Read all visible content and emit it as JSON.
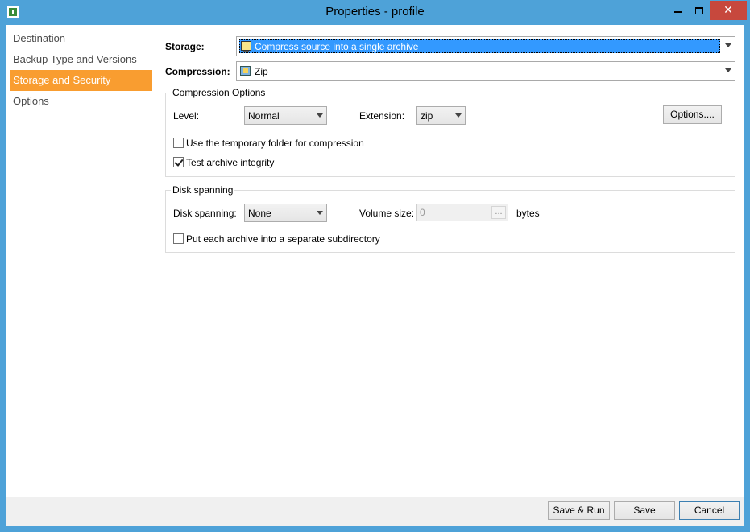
{
  "window": {
    "title": "Properties - profile"
  },
  "nav": {
    "items": [
      {
        "label": "Destination"
      },
      {
        "label": "Backup Type and Versions"
      },
      {
        "label": "Storage and Security"
      },
      {
        "label": "Options"
      }
    ],
    "active_index": 2,
    "active_color": "#f99d30"
  },
  "storage": {
    "label": "Storage:",
    "value": "Compress source into a single archive",
    "icon": "monitor-icon"
  },
  "compression": {
    "label": "Compression:",
    "value": "Zip",
    "icon": "zip-archive-icon"
  },
  "compression_options": {
    "title": "Compression Options",
    "level_label": "Level:",
    "level_value": "Normal",
    "extension_label": "Extension:",
    "extension_value": "zip",
    "options_button": "Options....",
    "temp_folder_label": "Use the temporary folder for compression",
    "temp_folder_checked": false,
    "test_integrity_label": "Test archive integrity",
    "test_integrity_checked": true
  },
  "disk_spanning": {
    "title": "Disk spanning",
    "spanning_label": "Disk spanning:",
    "spanning_value": "None",
    "volume_label": "Volume size:",
    "volume_value": "0",
    "ellipsis": "...",
    "bytes_label": "bytes",
    "subdir_label": "Put each archive into a separate subdirectory",
    "subdir_checked": false
  },
  "footer": {
    "save_run": "Save & Run",
    "save": "Save",
    "cancel": "Cancel"
  }
}
